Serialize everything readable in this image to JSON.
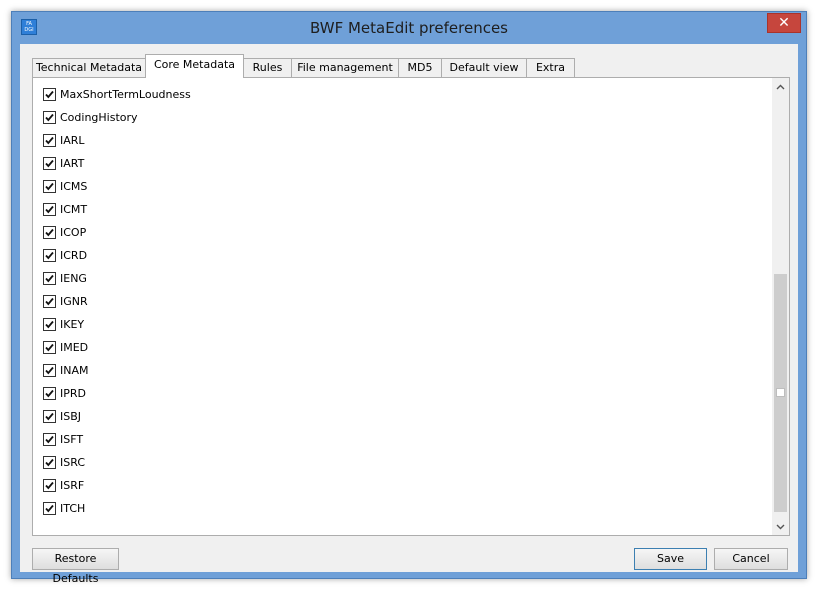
{
  "window": {
    "title": "BWF MetaEdit preferences",
    "app_icon_text_top": "FA",
    "app_icon_text_bottom": "DGI",
    "close_glyph": "✕"
  },
  "tabs": [
    {
      "label": "Technical Metadata",
      "active": false
    },
    {
      "label": "Core Metadata",
      "active": true
    },
    {
      "label": "Rules",
      "active": false
    },
    {
      "label": "File management",
      "active": false
    },
    {
      "label": "MD5",
      "active": false
    },
    {
      "label": "Default view",
      "active": false
    },
    {
      "label": "Extra",
      "active": false
    }
  ],
  "items": [
    {
      "label": "MaxShortTermLoudness",
      "checked": true
    },
    {
      "label": "CodingHistory",
      "checked": true
    },
    {
      "label": "IARL",
      "checked": true
    },
    {
      "label": "IART",
      "checked": true
    },
    {
      "label": "ICMS",
      "checked": true
    },
    {
      "label": "ICMT",
      "checked": true
    },
    {
      "label": "ICOP",
      "checked": true
    },
    {
      "label": "ICRD",
      "checked": true
    },
    {
      "label": "IENG",
      "checked": true
    },
    {
      "label": "IGNR",
      "checked": true
    },
    {
      "label": "IKEY",
      "checked": true
    },
    {
      "label": "IMED",
      "checked": true
    },
    {
      "label": "INAM",
      "checked": true
    },
    {
      "label": "IPRD",
      "checked": true
    },
    {
      "label": "ISBJ",
      "checked": true
    },
    {
      "label": "ISFT",
      "checked": true
    },
    {
      "label": "ISRC",
      "checked": true
    },
    {
      "label": "ISRF",
      "checked": true
    },
    {
      "label": "ITCH",
      "checked": true
    }
  ],
  "scroll_position": 1.0,
  "buttons": {
    "restore": "Restore Defaults",
    "save": "Save",
    "cancel": "Cancel"
  },
  "colors": {
    "window_frame": "#6fa0d8",
    "close_button": "#c6463d",
    "default_button_border": "#3c7fb1"
  }
}
